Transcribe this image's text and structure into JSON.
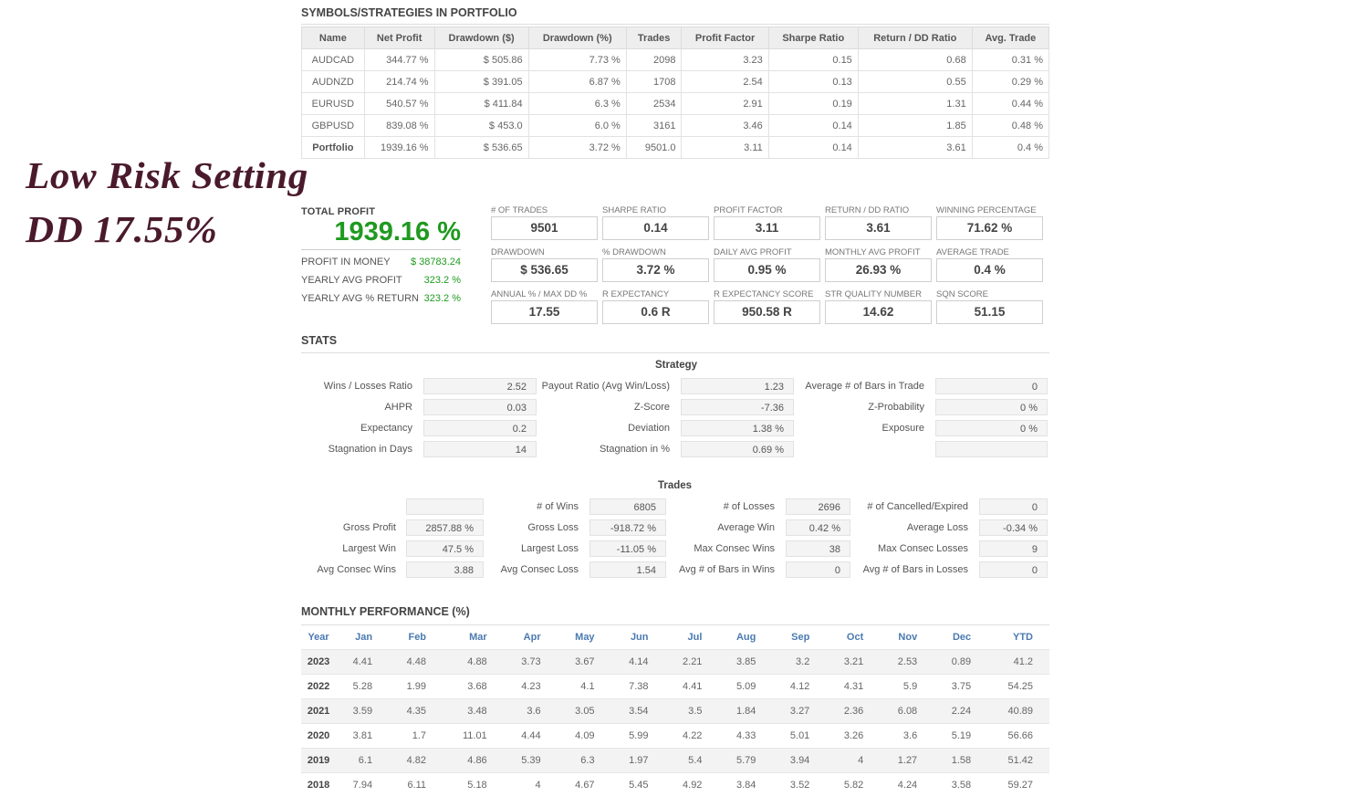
{
  "overlay": {
    "line1": "Low Risk Setting",
    "line2": "DD 17.55%"
  },
  "symbols": {
    "title": "SYMBOLS/STRATEGIES IN PORTFOLIO",
    "headers": [
      "Name",
      "Net Profit",
      "Drawdown ($)",
      "Drawdown (%)",
      "Trades",
      "Profit Factor",
      "Sharpe Ratio",
      "Return / DD Ratio",
      "Avg. Trade"
    ],
    "rows": [
      [
        "AUDCAD",
        "344.77 %",
        "$ 505.86",
        "7.73 %",
        "2098",
        "3.23",
        "0.15",
        "0.68",
        "0.31 %"
      ],
      [
        "AUDNZD",
        "214.74 %",
        "$ 391.05",
        "6.87 %",
        "1708",
        "2.54",
        "0.13",
        "0.55",
        "0.29 %"
      ],
      [
        "EURUSD",
        "540.57 %",
        "$ 411.84",
        "6.3 %",
        "2534",
        "2.91",
        "0.19",
        "1.31",
        "0.44 %"
      ],
      [
        "GBPUSD",
        "839.08 %",
        "$ 453.0",
        "6.0 %",
        "3161",
        "3.46",
        "0.14",
        "1.85",
        "0.48 %"
      ],
      [
        "Portfolio",
        "1939.16 %",
        "$ 536.65",
        "3.72 %",
        "9501.0",
        "3.11",
        "0.14",
        "3.61",
        "0.4 %"
      ]
    ]
  },
  "total_profit": {
    "label": "TOTAL PROFIT",
    "value": "1939.16 %",
    "rows": [
      {
        "label": "PROFIT IN MONEY",
        "value": "$ 38783.24"
      },
      {
        "label": "YEARLY AVG PROFIT",
        "value": "323.2 %"
      },
      {
        "label": "YEARLY AVG % RETURN",
        "value": "323.2 %"
      }
    ]
  },
  "kpis": [
    {
      "label": "# OF TRADES",
      "value": "9501"
    },
    {
      "label": "SHARPE RATIO",
      "value": "0.14"
    },
    {
      "label": "PROFIT FACTOR",
      "value": "3.11"
    },
    {
      "label": "RETURN / DD RATIO",
      "value": "3.61"
    },
    {
      "label": "WINNING PERCENTAGE",
      "value": "71.62 %"
    },
    {
      "label": "DRAWDOWN",
      "value": "$ 536.65"
    },
    {
      "label": "% DRAWDOWN",
      "value": "3.72 %"
    },
    {
      "label": "DAILY AVG PROFIT",
      "value": "0.95 %"
    },
    {
      "label": "MONTHLY AVG PROFIT",
      "value": "26.93 %"
    },
    {
      "label": "AVERAGE TRADE",
      "value": "0.4 %"
    },
    {
      "label": "ANNUAL % / MAX DD %",
      "value": "17.55"
    },
    {
      "label": "R EXPECTANCY",
      "value": "0.6 R"
    },
    {
      "label": "R EXPECTANCY SCORE",
      "value": "950.58 R"
    },
    {
      "label": "STR QUALITY NUMBER",
      "value": "14.62"
    },
    {
      "label": "SQN SCORE",
      "value": "51.15"
    }
  ],
  "stats": {
    "title": "STATS",
    "strategy": {
      "title": "Strategy",
      "col1": [
        {
          "label": "Wins / Losses Ratio",
          "value": "2.52"
        },
        {
          "label": "AHPR",
          "value": "0.03"
        },
        {
          "label": "Expectancy",
          "value": "0.2"
        },
        {
          "label": "Stagnation in Days",
          "value": "14"
        }
      ],
      "col2": [
        {
          "label": "Payout Ratio (Avg Win/Loss)",
          "value": "1.23"
        },
        {
          "label": "Z-Score",
          "value": "-7.36"
        },
        {
          "label": "Deviation",
          "value": "1.38 %"
        },
        {
          "label": "Stagnation in %",
          "value": "0.69 %"
        }
      ],
      "col3": [
        {
          "label": "Average # of Bars in Trade",
          "value": "0"
        },
        {
          "label": "Z-Probability",
          "value": "0 %"
        },
        {
          "label": "Exposure",
          "value": "0 %"
        },
        {
          "label": "",
          "value": ""
        }
      ]
    },
    "trades": {
      "title": "Trades",
      "col1": [
        {
          "label": "",
          "value": ""
        },
        {
          "label": "Gross Profit",
          "value": "2857.88 %"
        },
        {
          "label": "Largest Win",
          "value": "47.5 %"
        },
        {
          "label": "Avg Consec Wins",
          "value": "3.88"
        }
      ],
      "col2": [
        {
          "label": "# of Wins",
          "value": "6805"
        },
        {
          "label": "Gross Loss",
          "value": "-918.72 %"
        },
        {
          "label": "Largest Loss",
          "value": "-11.05 %"
        },
        {
          "label": "Avg Consec Loss",
          "value": "1.54"
        }
      ],
      "col3": [
        {
          "label": "# of Losses",
          "value": "2696"
        },
        {
          "label": "Average Win",
          "value": "0.42 %"
        },
        {
          "label": "Max Consec Wins",
          "value": "38"
        },
        {
          "label": "Avg # of Bars in Wins",
          "value": "0"
        }
      ],
      "col4": [
        {
          "label": "# of Cancelled/Expired",
          "value": "0"
        },
        {
          "label": "Average Loss",
          "value": "-0.34 %"
        },
        {
          "label": "Max Consec Losses",
          "value": "9"
        },
        {
          "label": "Avg # of Bars in Losses",
          "value": "0"
        }
      ]
    }
  },
  "monthly": {
    "title": "MONTHLY PERFORMANCE (%)",
    "headers": [
      "Year",
      "Jan",
      "Feb",
      "Mar",
      "Apr",
      "May",
      "Jun",
      "Jul",
      "Aug",
      "Sep",
      "Oct",
      "Nov",
      "Dec",
      "YTD"
    ],
    "rows": [
      [
        "2023",
        "4.41",
        "4.48",
        "4.88",
        "3.73",
        "3.67",
        "4.14",
        "2.21",
        "3.85",
        "3.2",
        "3.21",
        "2.53",
        "0.89",
        "41.2"
      ],
      [
        "2022",
        "5.28",
        "1.99",
        "3.68",
        "4.23",
        "4.1",
        "7.38",
        "4.41",
        "5.09",
        "4.12",
        "4.31",
        "5.9",
        "3.75",
        "54.25"
      ],
      [
        "2021",
        "3.59",
        "4.35",
        "3.48",
        "3.6",
        "3.05",
        "3.54",
        "3.5",
        "1.84",
        "3.27",
        "2.36",
        "6.08",
        "2.24",
        "40.89"
      ],
      [
        "2020",
        "3.81",
        "1.7",
        "11.01",
        "4.44",
        "4.09",
        "5.99",
        "4.22",
        "4.33",
        "5.01",
        "3.26",
        "3.6",
        "5.19",
        "56.66"
      ],
      [
        "2019",
        "6.1",
        "4.82",
        "4.86",
        "5.39",
        "6.3",
        "1.97",
        "5.4",
        "5.79",
        "3.94",
        "4",
        "1.27",
        "1.58",
        "51.42"
      ],
      [
        "2018",
        "7.94",
        "6.11",
        "5.18",
        "4",
        "4.67",
        "5.45",
        "4.92",
        "3.84",
        "3.52",
        "5.82",
        "4.24",
        "3.58",
        "59.27"
      ]
    ]
  }
}
